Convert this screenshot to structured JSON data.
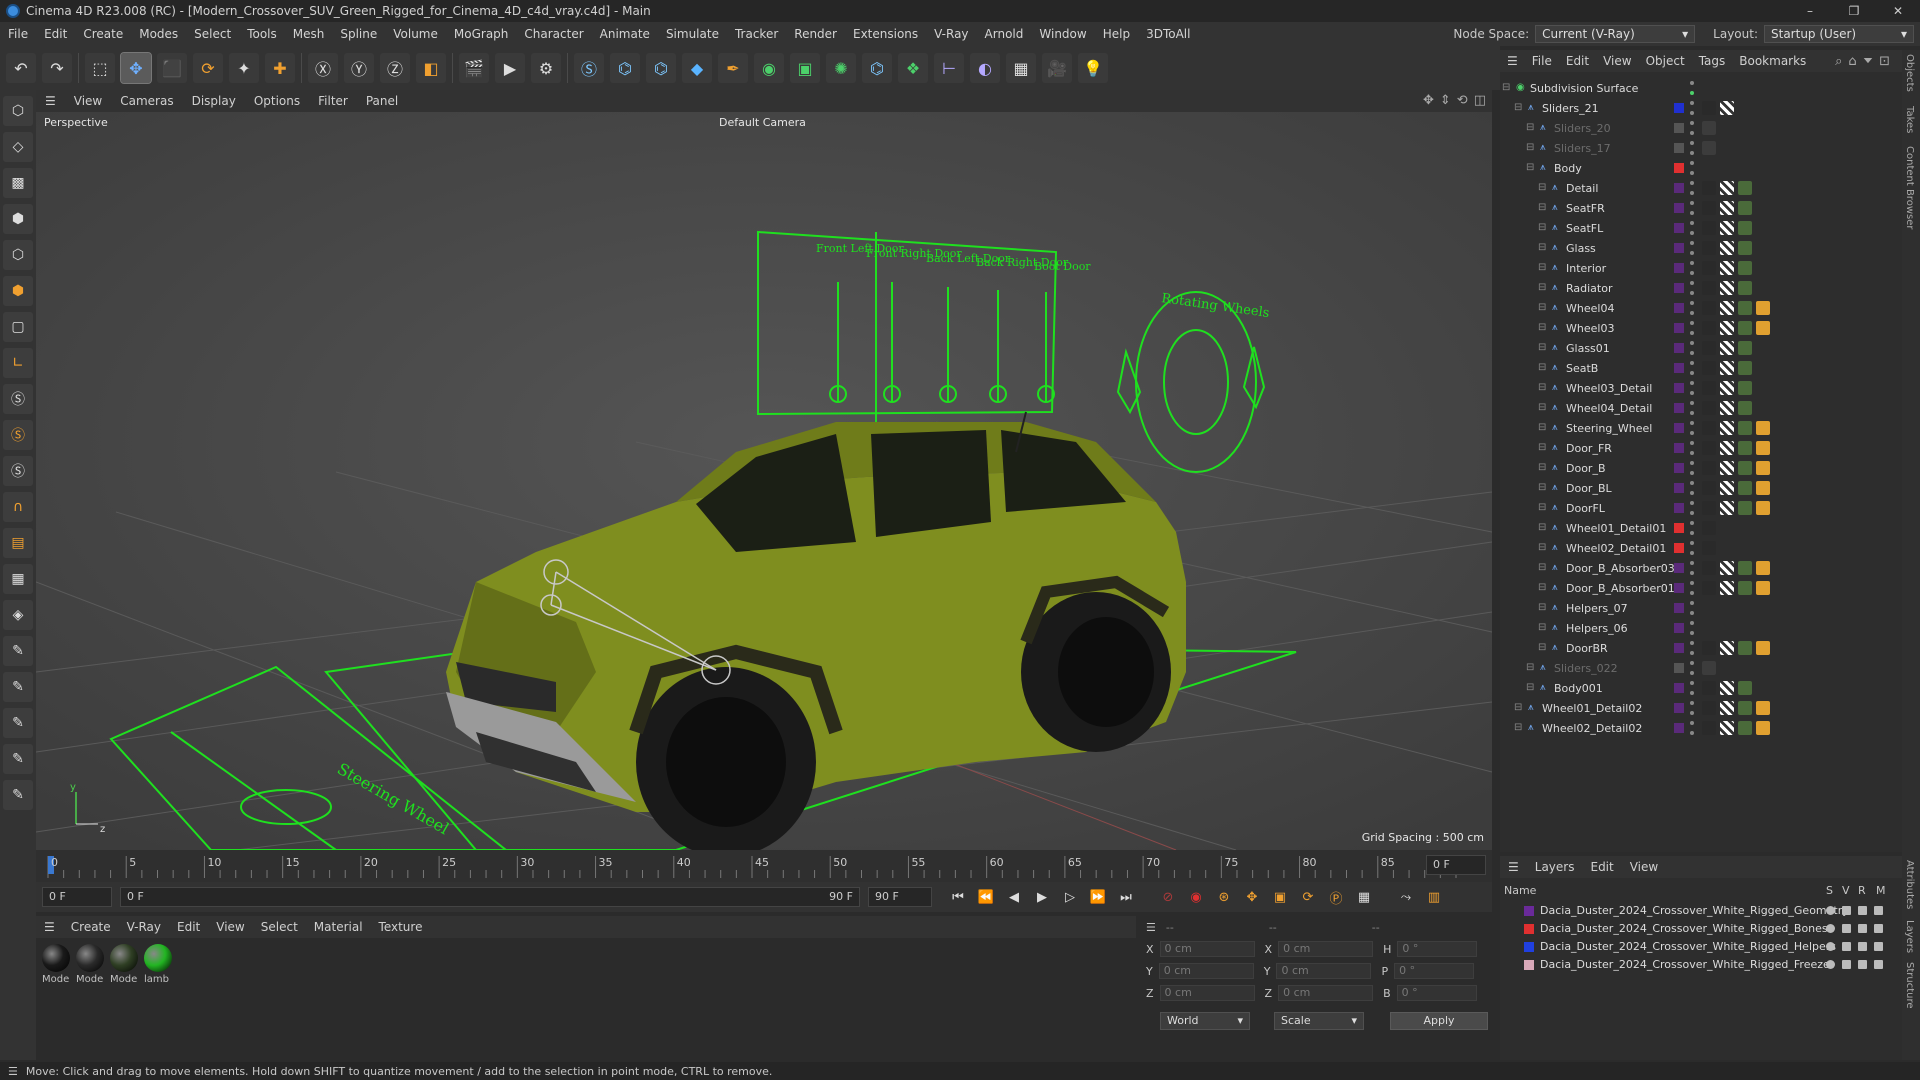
{
  "window": {
    "title": "Cinema 4D R23.008 (RC) - [Modern_Crossover_SUV_Green_Rigged_for_Cinema_4D_c4d_vray.c4d] - Main",
    "controls": [
      "–",
      "❐",
      "✕"
    ]
  },
  "menubar": {
    "items": [
      "File",
      "Edit",
      "Create",
      "Modes",
      "Select",
      "Tools",
      "Mesh",
      "Spline",
      "Volume",
      "MoGraph",
      "Character",
      "Animate",
      "Simulate",
      "Tracker",
      "Render",
      "Extensions",
      "V-Ray",
      "Arnold",
      "Window",
      "Help",
      "3DToAll"
    ],
    "node_space_label": "Node Space:",
    "node_space_value": "Current (V-Ray)",
    "layout_label": "Layout:",
    "layout_value": "Startup (User)"
  },
  "viewport": {
    "menu": [
      "View",
      "Cameras",
      "Display",
      "Options",
      "Filter",
      "Panel"
    ],
    "label": "Perspective",
    "camera": "Default Camera",
    "grid_spacing": "Grid Spacing : 500 cm",
    "slider_labels": [
      "Front Left Door",
      "Front Right Door",
      "Back Left Door",
      "Back Right Door",
      "Boot Door"
    ],
    "rotating_label": "Rotating Wheels",
    "steering_label": "Steering Wheel"
  },
  "timeline": {
    "ticks": [
      "0",
      "5",
      "10",
      "15",
      "20",
      "25",
      "30",
      "35",
      "40",
      "45",
      "50",
      "55",
      "60",
      "65",
      "70",
      "75",
      "80",
      "85",
      "90"
    ],
    "current_frame": "0 F",
    "start": "0 F",
    "start2": "0 F",
    "end": "90 F",
    "end2": "90 F"
  },
  "materials": {
    "menu": [
      "Create",
      "V-Ray",
      "Edit",
      "View",
      "Select",
      "Material",
      "Texture"
    ],
    "items": [
      {
        "label": "Mode",
        "color": "#1a1a1a"
      },
      {
        "label": "Mode",
        "color": "#2a2a2a"
      },
      {
        "label": "Mode",
        "color": "#2f3f24"
      },
      {
        "label": "lamb",
        "color": "#22b522"
      }
    ]
  },
  "coords": {
    "rows": [
      {
        "a": "X",
        "av": "0 cm",
        "b": "X",
        "bv": "0 cm",
        "c": "H",
        "cv": "0 °"
      },
      {
        "a": "Y",
        "av": "0 cm",
        "b": "Y",
        "bv": "0 cm",
        "c": "P",
        "cv": "0 °"
      },
      {
        "a": "Z",
        "av": "0 cm",
        "b": "Z",
        "bv": "0 cm",
        "c": "B",
        "cv": "0 °"
      }
    ],
    "head1": "--",
    "head2": "--",
    "head3": "--",
    "world": "World",
    "scale": "Scale",
    "apply": "Apply"
  },
  "objects": {
    "menu": [
      "File",
      "Edit",
      "View",
      "Object",
      "Tags",
      "Bookmarks"
    ],
    "rows": [
      {
        "name": "Subdivision Surface",
        "indent": 0,
        "color": "",
        "dim": false,
        "tags": 0
      },
      {
        "name": "Sliders_21",
        "indent": 1,
        "color": "#2030d0",
        "dim": false,
        "tags": 2
      },
      {
        "name": "Sliders_20",
        "indent": 2,
        "color": "#555555",
        "dim": true,
        "tags": 1
      },
      {
        "name": "Sliders_17",
        "indent": 2,
        "color": "#555555",
        "dim": true,
        "tags": 1
      },
      {
        "name": "Body",
        "indent": 2,
        "color": "#e03030",
        "dim": false,
        "tags": 0
      },
      {
        "name": "Detail",
        "indent": 3,
        "color": "#5a2a7a",
        "dim": false,
        "tags": 3
      },
      {
        "name": "SeatFR",
        "indent": 3,
        "color": "#5a2a7a",
        "dim": false,
        "tags": 3
      },
      {
        "name": "SeatFL",
        "indent": 3,
        "color": "#5a2a7a",
        "dim": false,
        "tags": 3
      },
      {
        "name": "Glass",
        "indent": 3,
        "color": "#5a2a7a",
        "dim": false,
        "tags": 3
      },
      {
        "name": "Interior",
        "indent": 3,
        "color": "#5a2a7a",
        "dim": false,
        "tags": 3
      },
      {
        "name": "Radiator",
        "indent": 3,
        "color": "#5a2a7a",
        "dim": false,
        "tags": 3
      },
      {
        "name": "Wheel04",
        "indent": 3,
        "color": "#5a2a7a",
        "dim": false,
        "tags": 4
      },
      {
        "name": "Wheel03",
        "indent": 3,
        "color": "#5a2a7a",
        "dim": false,
        "tags": 4
      },
      {
        "name": "Glass01",
        "indent": 3,
        "color": "#5a2a7a",
        "dim": false,
        "tags": 3
      },
      {
        "name": "SeatB",
        "indent": 3,
        "color": "#5a2a7a",
        "dim": false,
        "tags": 3
      },
      {
        "name": "Wheel03_Detail",
        "indent": 3,
        "color": "#5a2a7a",
        "dim": false,
        "tags": 3
      },
      {
        "name": "Wheel04_Detail",
        "indent": 3,
        "color": "#5a2a7a",
        "dim": false,
        "tags": 3
      },
      {
        "name": "Steering_Wheel",
        "indent": 3,
        "color": "#5a2a7a",
        "dim": false,
        "tags": 4
      },
      {
        "name": "Door_FR",
        "indent": 3,
        "color": "#5a2a7a",
        "dim": false,
        "tags": 4
      },
      {
        "name": "Door_B",
        "indent": 3,
        "color": "#5a2a7a",
        "dim": false,
        "tags": 4
      },
      {
        "name": "Door_BL",
        "indent": 3,
        "color": "#5a2a7a",
        "dim": false,
        "tags": 4
      },
      {
        "name": "DoorFL",
        "indent": 3,
        "color": "#5a2a7a",
        "dim": false,
        "tags": 4
      },
      {
        "name": "Wheel01_Detail01",
        "indent": 3,
        "color": "#e03030",
        "dim": false,
        "tags": 1
      },
      {
        "name": "Wheel02_Detail01",
        "indent": 3,
        "color": "#e03030",
        "dim": false,
        "tags": 1
      },
      {
        "name": "Door_B_Absorber03",
        "indent": 3,
        "color": "#5a2a7a",
        "dim": false,
        "tags": 4
      },
      {
        "name": "Door_B_Absorber01",
        "indent": 3,
        "color": "#5a2a7a",
        "dim": false,
        "tags": 4
      },
      {
        "name": "Helpers_07",
        "indent": 3,
        "color": "#5a2a7a",
        "dim": false,
        "tags": 0
      },
      {
        "name": "Helpers_06",
        "indent": 3,
        "color": "#5a2a7a",
        "dim": false,
        "tags": 0
      },
      {
        "name": "DoorBR",
        "indent": 3,
        "color": "#5a2a7a",
        "dim": false,
        "tags": 4
      },
      {
        "name": "Sliders_022",
        "indent": 2,
        "color": "#555555",
        "dim": true,
        "tags": 1
      },
      {
        "name": "Body001",
        "indent": 2,
        "color": "#5a2a7a",
        "dim": false,
        "tags": 3
      },
      {
        "name": "Wheel01_Detail02",
        "indent": 1,
        "color": "#5a2a7a",
        "dim": false,
        "tags": 4
      },
      {
        "name": "Wheel02_Detail02",
        "indent": 1,
        "color": "#5a2a7a",
        "dim": false,
        "tags": 4
      }
    ]
  },
  "layers": {
    "menu": [
      "Layers",
      "Edit",
      "View"
    ],
    "col_name": "Name",
    "cols": [
      "S",
      "V",
      "R",
      "M"
    ],
    "rows": [
      {
        "name": "Dacia_Duster_2024_Crossover_White_Rigged_Geometry",
        "color": "#6a2a9a"
      },
      {
        "name": "Dacia_Duster_2024_Crossover_White_Rigged_Bones",
        "color": "#e03030"
      },
      {
        "name": "Dacia_Duster_2024_Crossover_White_Rigged_Helpers",
        "color": "#2040e0"
      },
      {
        "name": "Dacia_Duster_2024_Crossover_White_Rigged_Freeze",
        "color": "#d8a8b8"
      }
    ]
  },
  "side_tabs": [
    "Objects",
    "Takes",
    "Content Browser",
    "Attributes",
    "Layers",
    "Structure"
  ],
  "status": "Move: Click and drag to move elements. Hold down SHIFT to quantize movement / add to the selection in point mode, CTRL to remove."
}
